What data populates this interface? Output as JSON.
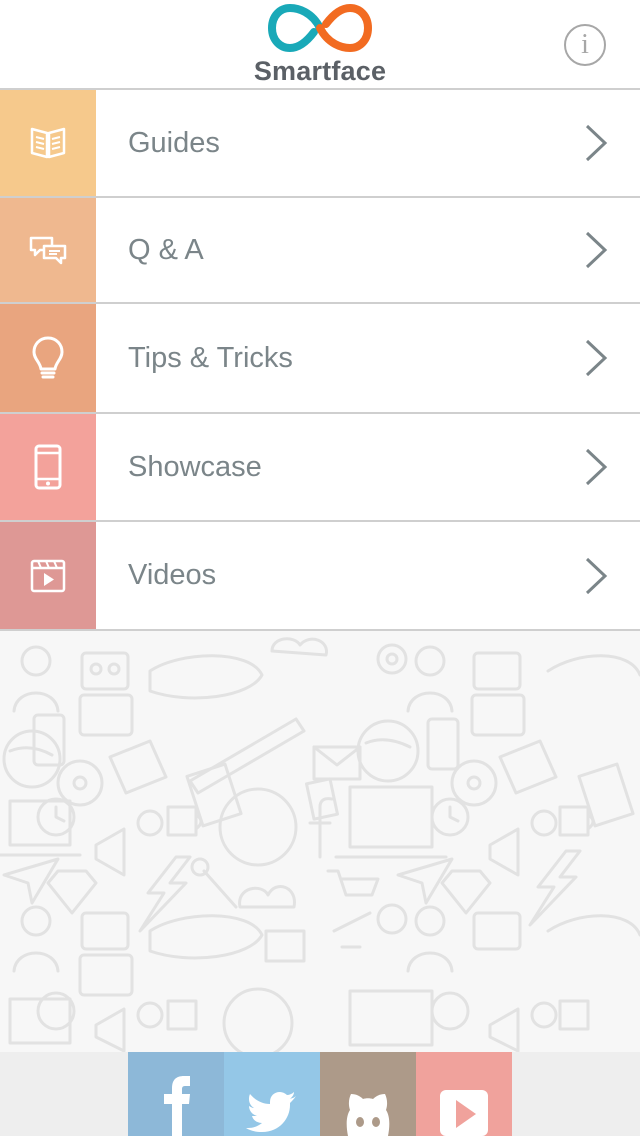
{
  "header": {
    "brand": "Smartface",
    "info_icon": "info-icon",
    "colors": {
      "logo_teal": "#19a9b8",
      "logo_orange": "#f26b21",
      "brand_text": "#5b6066"
    }
  },
  "menu": {
    "items": [
      {
        "label": "Guides",
        "icon": "open-book-icon",
        "color": "#f6c98c"
      },
      {
        "label": "Q & A",
        "icon": "chat-bubbles-icon",
        "color": "#efb88f"
      },
      {
        "label": "Tips & Tricks",
        "icon": "lightbulb-icon",
        "color": "#e9a57f"
      },
      {
        "label": "Showcase",
        "icon": "smartphone-icon",
        "color": "#f3a29b"
      },
      {
        "label": "Videos",
        "icon": "video-player-icon",
        "color": "#de9895"
      }
    ],
    "chevron_icon": "chevron-right-icon"
  },
  "footer": {
    "social": [
      {
        "name": "facebook",
        "icon": "facebook-icon",
        "color": "#8db8d8"
      },
      {
        "name": "twitter",
        "icon": "twitter-icon",
        "color": "#94c7e7"
      },
      {
        "name": "github",
        "icon": "github-octocat-icon",
        "color": "#ad9a89"
      },
      {
        "name": "youtube",
        "icon": "youtube-icon",
        "color": "#f0a29c"
      }
    ]
  }
}
